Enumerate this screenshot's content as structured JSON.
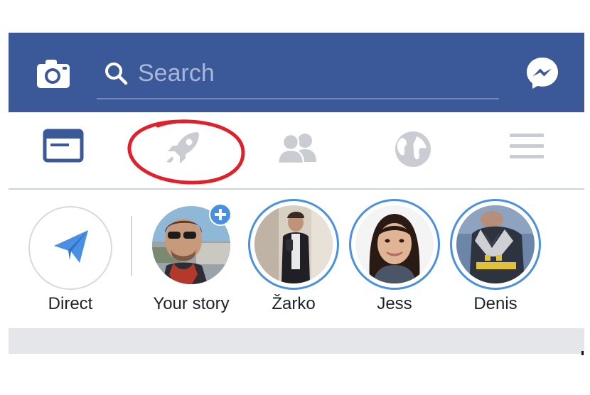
{
  "search": {
    "placeholder": "Search"
  },
  "icons": {
    "camera": "camera-icon",
    "search": "search-icon",
    "messenger": "messenger-icon",
    "feed": "news-feed-icon",
    "explore": "rocket-icon",
    "friends": "friends-icon",
    "globe": "globe-icon",
    "menu": "hamburger-menu-icon",
    "direct": "paper-plane-icon",
    "add": "plus-icon"
  },
  "colors": {
    "brand": "#3b5998",
    "active_tab": "#3b5998",
    "inactive_tab": "#c9ccd1",
    "story_ring": "#4a90e2",
    "annotation": "#e0202a"
  },
  "stories": [
    {
      "label": "Direct"
    },
    {
      "label": "Your story"
    },
    {
      "label": "Žarko"
    },
    {
      "label": "Jess"
    },
    {
      "label": "Denis"
    }
  ]
}
